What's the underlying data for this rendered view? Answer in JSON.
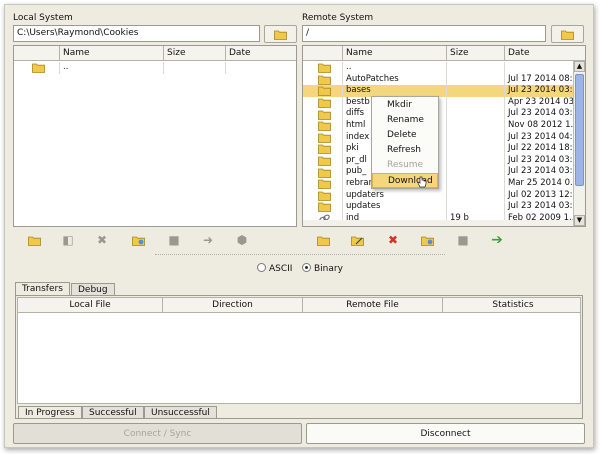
{
  "local": {
    "title": "Local System",
    "path": "C:\\Users\\Raymond\\Cookies",
    "columns": [
      "Name",
      "Size",
      "Date"
    ],
    "rows": [
      {
        "name": "..",
        "size": "",
        "date": "",
        "icon": "folder-icon"
      }
    ]
  },
  "remote": {
    "title": "Remote System",
    "path": "/",
    "columns": [
      "Name",
      "Size",
      "Date"
    ],
    "rows": [
      {
        "name": "..",
        "size": "",
        "date": "",
        "icon": "folder-icon"
      },
      {
        "name": "AutoPatches",
        "size": "",
        "date": "Jul 17 2014 08:...",
        "icon": "folder-icon"
      },
      {
        "name": "bases",
        "size": "",
        "date": "Jul 23 2014 03:...",
        "icon": "folder-icon",
        "selected": true
      },
      {
        "name": "bestb",
        "size": "",
        "date": "Apr 23 2014 03:...",
        "icon": "folder-icon"
      },
      {
        "name": "diffs",
        "size": "",
        "date": "Jul 23 2014 03:...",
        "icon": "folder-icon"
      },
      {
        "name": "html",
        "size": "",
        "date": "Nov 08 2012 1...",
        "icon": "folder-icon"
      },
      {
        "name": "index",
        "size": "",
        "date": "Jul 23 2014 04:...",
        "icon": "folder-icon"
      },
      {
        "name": "pki",
        "size": "",
        "date": "Jul 22 2014 18:...",
        "icon": "folder-icon"
      },
      {
        "name": "pr_dl",
        "size": "",
        "date": "Jul 23 2014 03:...",
        "icon": "folder-icon"
      },
      {
        "name": "pub_",
        "size": "",
        "date": "Jul 23 2014 03:...",
        "icon": "folder-icon"
      },
      {
        "name": "rebranding",
        "size": "",
        "date": "Mar 25 2014 0...",
        "icon": "folder-icon"
      },
      {
        "name": "updaters",
        "size": "",
        "date": "Jul 02 2013 12:...",
        "icon": "folder-icon"
      },
      {
        "name": "updates",
        "size": "",
        "date": "Jul 23 2014 03:...",
        "icon": "folder-icon"
      },
      {
        "name": "ind",
        "size": "19 b",
        "date": "Feb 02 2009 1...",
        "icon": "link-icon"
      }
    ]
  },
  "context_menu": {
    "items": [
      {
        "label": "Mkdir",
        "enabled": true
      },
      {
        "label": "Rename",
        "enabled": true
      },
      {
        "label": "Delete",
        "enabled": true
      },
      {
        "label": "Refresh",
        "enabled": true
      },
      {
        "label": "Resume",
        "enabled": false
      },
      {
        "label": "Download",
        "enabled": true,
        "highlighted": true
      }
    ]
  },
  "transfer_mode": {
    "ascii_label": "ASCII",
    "binary_label": "Binary",
    "selected": "Binary"
  },
  "tabs": {
    "top": [
      "Transfers",
      "Debug"
    ],
    "active_top": "Transfers",
    "transfer_columns": [
      "Local File",
      "Direction",
      "Remote File",
      "Statistics"
    ],
    "bottom": [
      "In Progress",
      "Successful",
      "Unsuccessful"
    ],
    "active_bottom": "In Progress"
  },
  "buttons": {
    "connect": "Connect / Sync",
    "disconnect": "Disconnect"
  },
  "colors": {
    "window_bg": "#eeece1",
    "selection": "#f4d67c",
    "folder": "#f1c94a",
    "delete_red": "#d8302a",
    "download_green": "#3aa537",
    "scroll_thumb": "#9db4e6"
  }
}
